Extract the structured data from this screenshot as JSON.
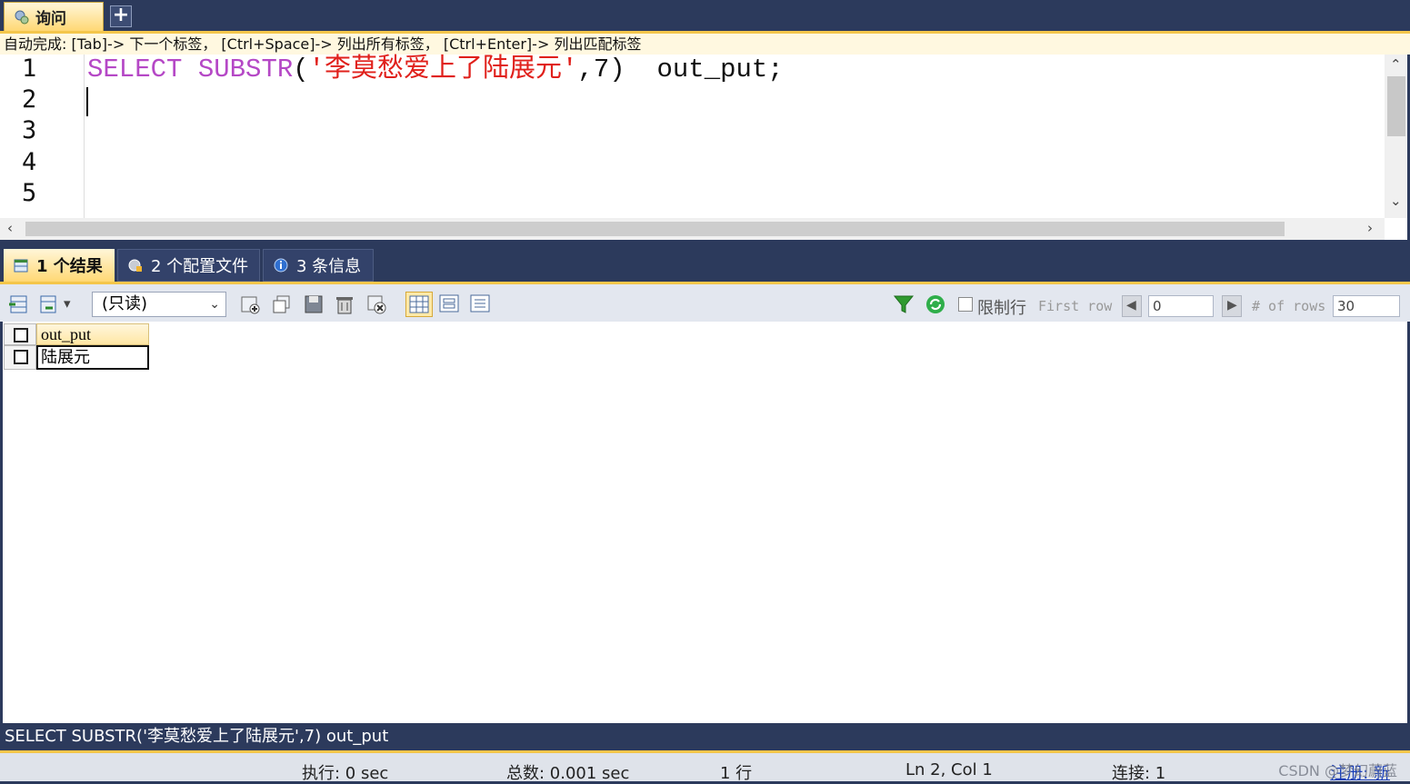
{
  "tabs": {
    "query_tab": "询问",
    "add": "+"
  },
  "hint": "自动完成: [Tab]-> 下一个标签， [Ctrl+Space]-> 列出所有标签， [Ctrl+Enter]-> 列出匹配标签",
  "editor": {
    "line_numbers": [
      "1",
      "2",
      "3",
      "4",
      "5"
    ],
    "code": {
      "kw1": "SELECT",
      "kw2": "SUBSTR",
      "open": "(",
      "str": "'李莫愁爱上了陆展元'",
      "rest": ",7)  out_put;"
    }
  },
  "result_tabs": [
    {
      "label": "1 个结果"
    },
    {
      "label": "2 个配置文件"
    },
    {
      "label": "3 条信息"
    }
  ],
  "toolbar": {
    "mode_select": "(只读)",
    "limit_label": "限制行",
    "first_row_label": "First row",
    "first_row_value": "0",
    "rows_label": "# of rows",
    "rows_value": "30"
  },
  "grid": {
    "columns": [
      "out_put"
    ],
    "rows": [
      [
        "陆展元"
      ]
    ]
  },
  "sql_line": "SELECT SUBSTR('李莫愁爱上了陆展元',7)  out_put",
  "status": {
    "exec": "执行: 0 sec",
    "total": "总数: 0.001 sec",
    "rows": "1 行",
    "pos": "Ln 2, Col 1",
    "conn": "连接: 1",
    "reg": "注册: 新",
    "watermark": "CSDN @梦幻蔚蓝"
  },
  "colors": {
    "accent": "#f4c64b",
    "frame": "#2c3a5c",
    "keyword": "#b548c6",
    "string": "#e0201b"
  }
}
